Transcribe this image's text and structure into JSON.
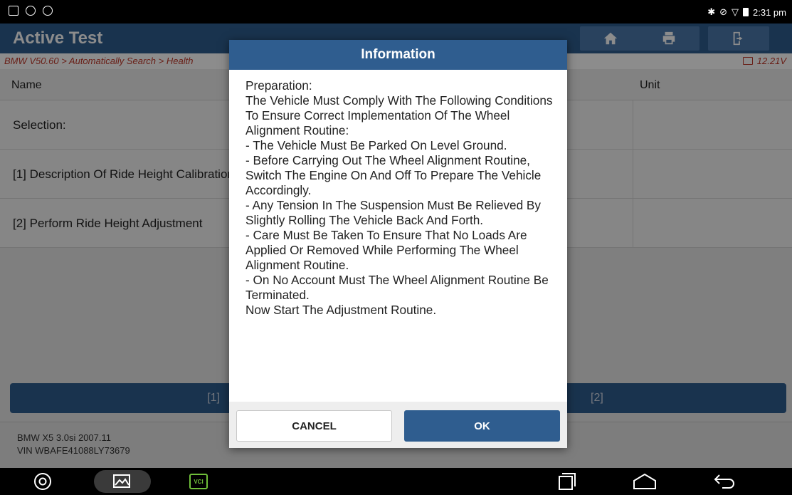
{
  "status_bar": {
    "time": "2:31 pm"
  },
  "app": {
    "title": "Active Test",
    "breadcrumb": "BMW V50.60 > Automatically Search > Health",
    "voltage": "12.21V",
    "table": {
      "headers": {
        "name": "Name",
        "unit": "Unit"
      },
      "rows": [
        {
          "name": "Selection:"
        },
        {
          "name": "[1] Description Of Ride Height Calibration"
        },
        {
          "name": "[2] Perform Ride Height Adjustment"
        }
      ]
    },
    "actions": {
      "btn1": "[1]",
      "btn2": "[2]"
    },
    "vehicle": {
      "model": "BMW X5 3.0si 2007.11",
      "vin": "VIN WBAFE41088LY73679"
    }
  },
  "dialog": {
    "title": "Information",
    "body": "Preparation:\nThe Vehicle Must Comply With The Following Conditions To Ensure Correct Implementation Of The Wheel Alignment Routine:\n- The Vehicle Must Be Parked On Level Ground.\n- Before Carrying Out The Wheel Alignment Routine, Switch The Engine On And Off To Prepare The Vehicle Accordingly.\n- Any Tension In The Suspension Must Be Relieved By Slightly Rolling The Vehicle Back And Forth.\n- Care  Must Be Taken To Ensure That No Loads Are Applied Or Removed While Performing The Wheel Alignment Routine.\n- On No Account Must The Wheel Alignment Routine Be Terminated.\nNow Start The Adjustment Routine.",
    "cancel_label": "CANCEL",
    "ok_label": "OK"
  },
  "navbar": {
    "vci_label": "VCI"
  },
  "colors": {
    "primary": "#2f5d8f",
    "breadcrumb": "#c0392b"
  }
}
